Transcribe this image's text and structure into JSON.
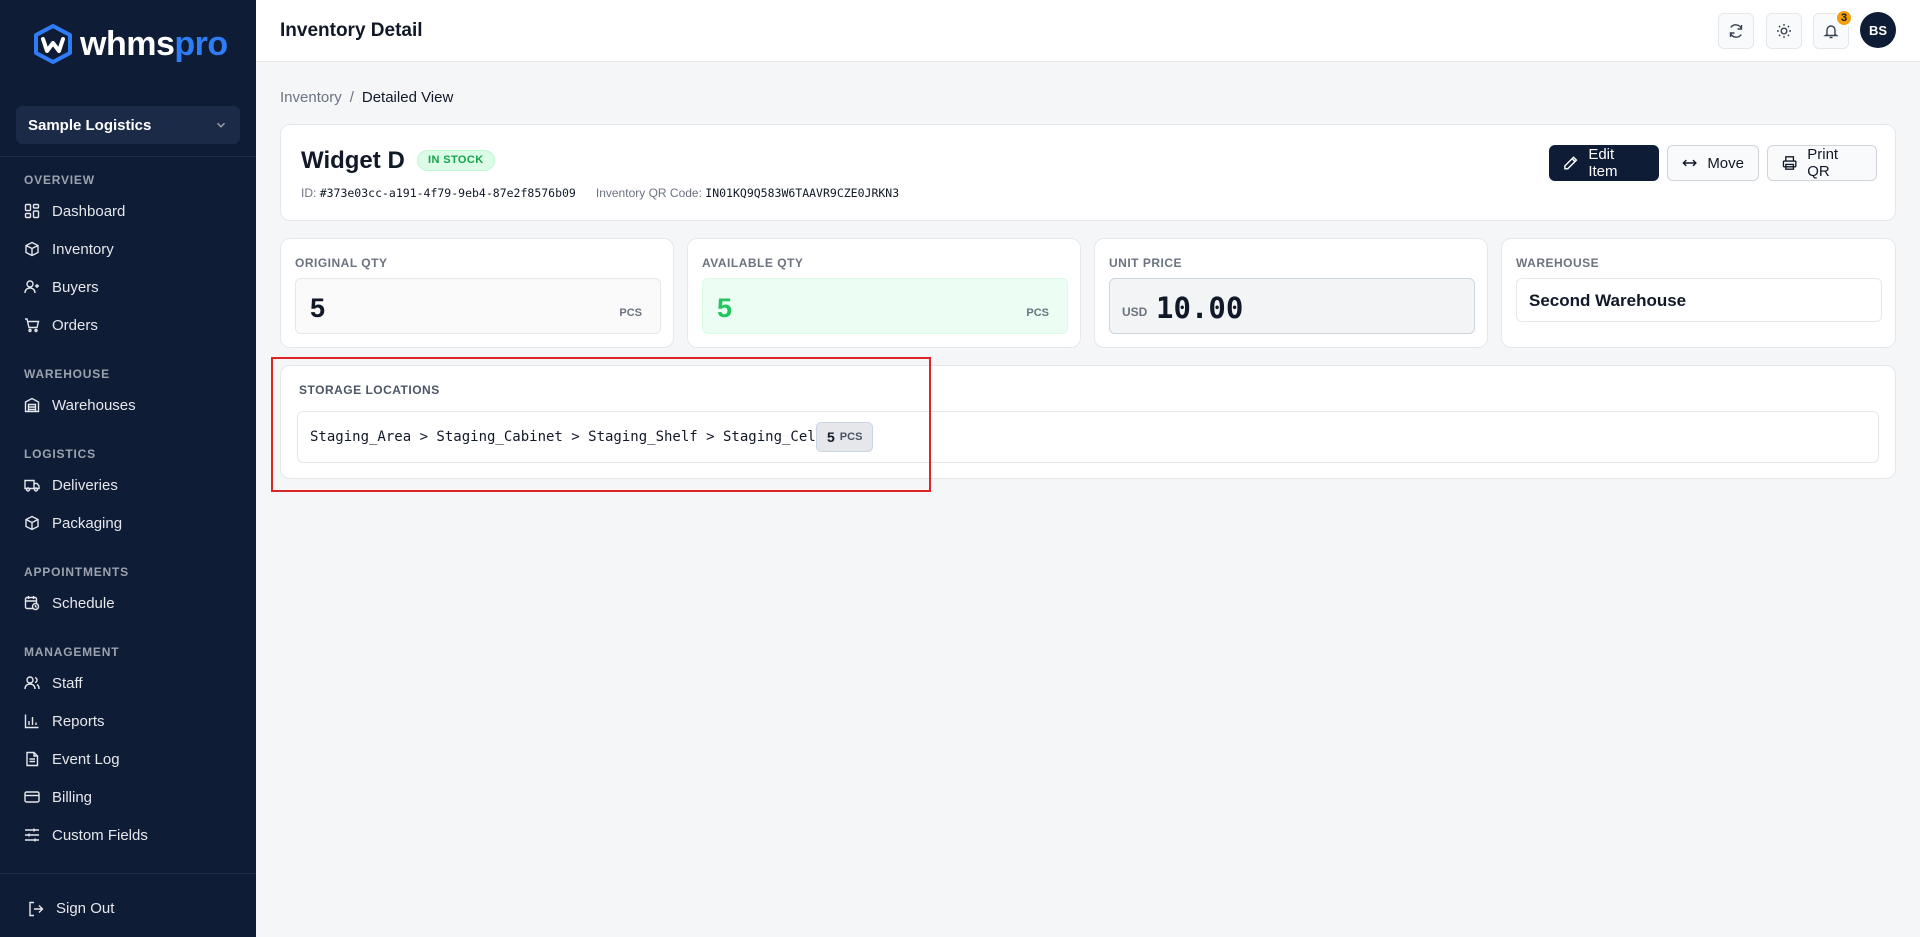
{
  "brand": {
    "name_a": "whms",
    "name_b": "pro",
    "accent": "#2f7df6"
  },
  "organization": {
    "selected": "Sample Logistics"
  },
  "nav": {
    "overview": {
      "title": "OVERVIEW",
      "items": [
        "Dashboard",
        "Inventory",
        "Buyers",
        "Orders"
      ]
    },
    "warehouse": {
      "title": "WAREHOUSE",
      "items": [
        "Warehouses"
      ]
    },
    "logistics": {
      "title": "LOGISTICS",
      "items": [
        "Deliveries",
        "Packaging"
      ]
    },
    "appointments": {
      "title": "APPOINTMENTS",
      "items": [
        "Schedule"
      ]
    },
    "management": {
      "title": "MANAGEMENT",
      "items": [
        "Staff",
        "Reports",
        "Event Log",
        "Billing",
        "Custom Fields"
      ]
    },
    "sign_out": "Sign Out"
  },
  "header": {
    "title": "Inventory Detail",
    "notification_count": "3",
    "avatar_initials": "BS"
  },
  "breadcrumb": {
    "parent": "Inventory",
    "separator": "/",
    "current": "Detailed View"
  },
  "item": {
    "name": "Widget D",
    "status": "IN STOCK",
    "id_label": "ID:",
    "id": "#373e03cc-a191-4f79-9eb4-87e2f8576b09",
    "qr_label": "Inventory QR Code:",
    "qr_code": "IN01KQ9Q583W6TAAVR9CZE0JRKN3"
  },
  "actions": {
    "edit": "Edit Item",
    "move": "Move",
    "print": "Print QR"
  },
  "stats": {
    "original": {
      "label": "ORIGINAL QTY",
      "value": "5",
      "unit": "PCS"
    },
    "available": {
      "label": "AVAILABLE QTY",
      "value": "5",
      "unit": "PCS"
    },
    "price": {
      "label": "UNIT PRICE",
      "currency": "USD",
      "value": "10.00"
    },
    "warehouse": {
      "label": "WAREHOUSE",
      "value": "Second Warehouse"
    }
  },
  "storage": {
    "label": "STORAGE LOCATIONS",
    "path": "Staging_Area > Staging_Cabinet > Staging_Shelf > Staging_Cell",
    "qty": "5",
    "unit": "PCS"
  }
}
